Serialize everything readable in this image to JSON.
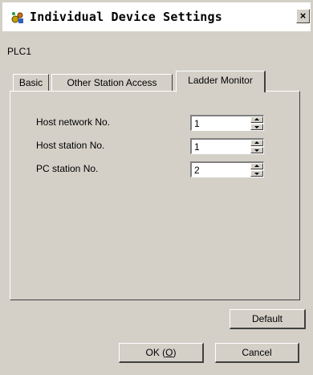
{
  "window": {
    "title": "Individual Device Settings",
    "close_label": "×"
  },
  "device_name": "PLC1",
  "tabs": [
    {
      "label": "Basic",
      "active": false
    },
    {
      "label": "Other Station Access",
      "active": false
    },
    {
      "label": "Ladder Monitor",
      "active": true
    }
  ],
  "fields": [
    {
      "label": "Host network No.",
      "value": "1"
    },
    {
      "label": "Host station No.",
      "value": "1"
    },
    {
      "label": "PC station No.",
      "value": "2"
    }
  ],
  "buttons": {
    "default": "Default",
    "ok_prefix": "OK (",
    "ok_key": "O",
    "ok_suffix": ")",
    "cancel": "Cancel"
  }
}
